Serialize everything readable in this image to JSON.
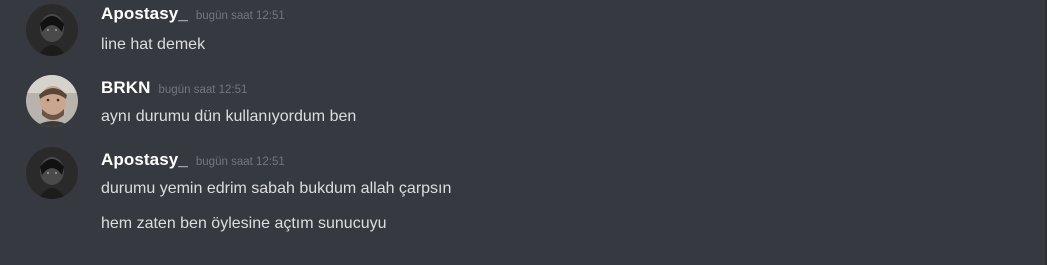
{
  "messages": [
    {
      "username": "Apostasy_",
      "timestamp": "bugün saat 12:51",
      "avatar_icon": "dark-portrait-avatar",
      "lines": [
        "line hat demek"
      ]
    },
    {
      "username": "BRKN",
      "timestamp": "bugün saat 12:51",
      "avatar_icon": "light-portrait-avatar",
      "lines": [
        "aynı durumu dün kullanıyordum ben"
      ]
    },
    {
      "username": "Apostasy_",
      "timestamp": "bugün saat 12:51",
      "avatar_icon": "dark-portrait-avatar",
      "lines": [
        "durumu yemin edrim sabah bukdum allah çarpsın",
        "hem zaten ben öylesine açtım sunucuyu"
      ]
    }
  ],
  "colors": {
    "background": "#36393f",
    "username": "#ffffff",
    "timestamp": "#72767d",
    "message_text": "#dcddde"
  }
}
